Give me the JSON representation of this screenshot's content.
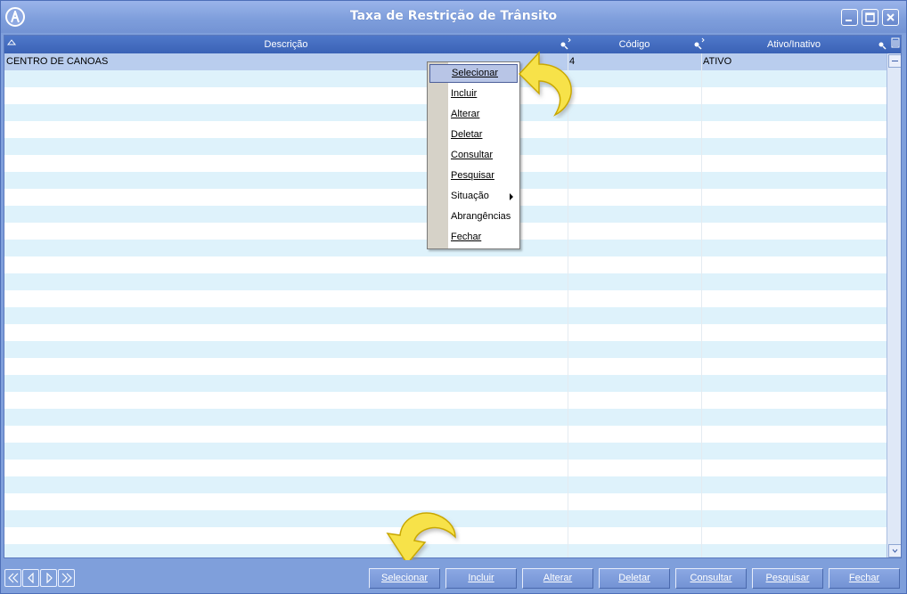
{
  "window": {
    "title": "Taxa de Restrição de Trânsito"
  },
  "grid": {
    "columns": [
      "Descrição",
      "Código",
      "Ativo/Inativo"
    ],
    "rows": [
      {
        "descricao": "CENTRO DE CANOAS",
        "codigo": "4",
        "ativo": "ATIVO"
      }
    ]
  },
  "context_menu": {
    "items": [
      {
        "label": "Selecionar",
        "active": true
      },
      {
        "label": "Incluir"
      },
      {
        "label": "Alterar"
      },
      {
        "label": "Deletar"
      },
      {
        "label": "Consultar"
      },
      {
        "label": "Pesquisar"
      },
      {
        "label": "Situação",
        "submenu": true
      },
      {
        "label": "Abrangências"
      },
      {
        "label": "Fechar"
      }
    ]
  },
  "footer": {
    "buttons": [
      "Selecionar",
      "Incluir",
      "Alterar",
      "Deletar",
      "Consultar",
      "Pesquisar",
      "Fechar"
    ]
  },
  "colors": {
    "window_bg": "#7f9fdb",
    "header_bg": "#3a62b6",
    "row_alt": "#def2fb",
    "row_selected": "#b9cdee",
    "arrow_yellow": "#f7e24a"
  }
}
